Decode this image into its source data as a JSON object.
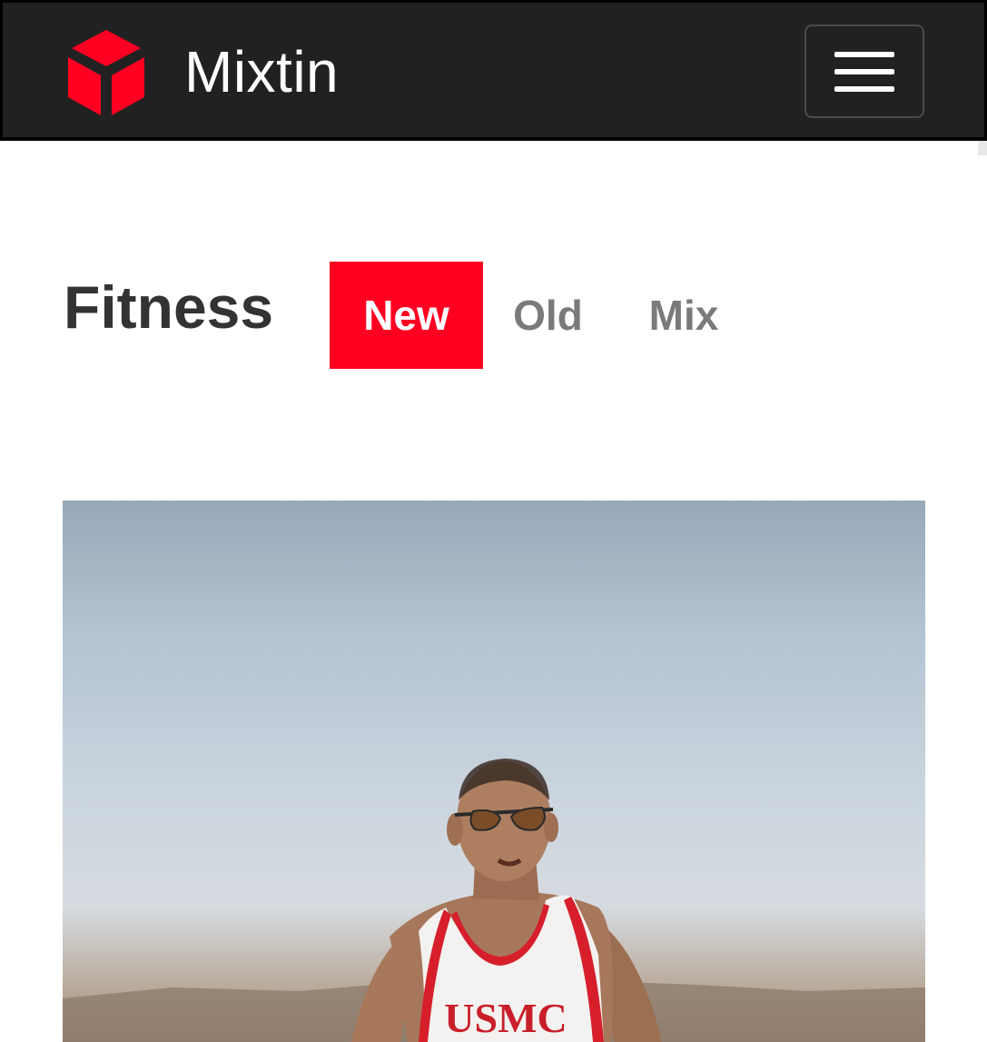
{
  "navbar": {
    "brand_name": "Mixtin",
    "logo_icon": "cube-logo-icon",
    "menu_icon": "hamburger-menu-icon"
  },
  "section": {
    "title": "Fitness",
    "tabs": [
      {
        "label": "New",
        "active": true
      },
      {
        "label": "Old",
        "active": false
      },
      {
        "label": "Mix",
        "active": false
      }
    ]
  },
  "photo": {
    "shirt_text": "USMC"
  },
  "colors": {
    "accent": "#ff0022",
    "navbar_bg": "#212121",
    "title_text": "#333333",
    "tab_inactive_text": "#7a7a7a"
  }
}
